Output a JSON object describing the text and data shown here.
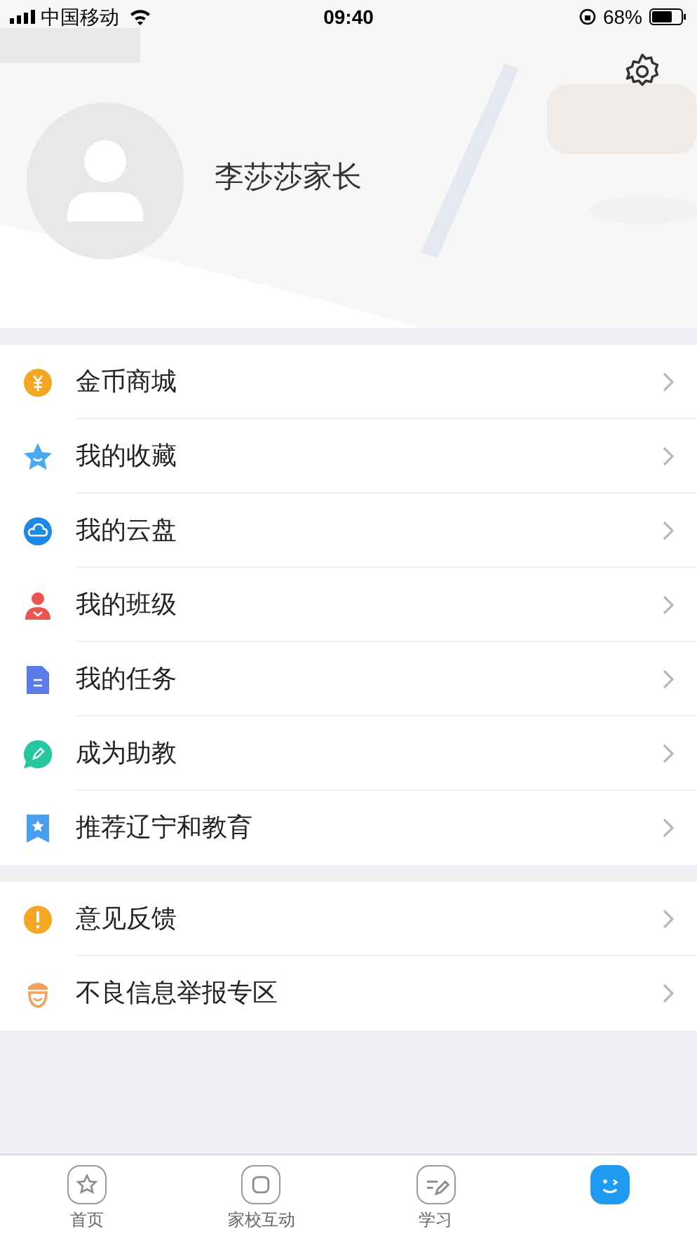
{
  "status_bar": {
    "carrier": "中国移动",
    "time": "09:40",
    "battery": "68%"
  },
  "profile": {
    "name": "李莎莎家长"
  },
  "menu_groups": [
    [
      {
        "label": "金币商城"
      },
      {
        "label": "我的收藏"
      },
      {
        "label": "我的云盘"
      },
      {
        "label": "我的班级"
      },
      {
        "label": "我的任务"
      },
      {
        "label": "成为助教"
      },
      {
        "label": "推荐辽宁和教育"
      }
    ],
    [
      {
        "label": "意见反馈"
      },
      {
        "label": "不良信息举报专区"
      }
    ]
  ],
  "tab_bar": [
    {
      "label": "首页",
      "selected": false
    },
    {
      "label": "家校互动",
      "selected": false
    },
    {
      "label": "学习",
      "selected": false
    },
    {
      "selected": true
    }
  ]
}
